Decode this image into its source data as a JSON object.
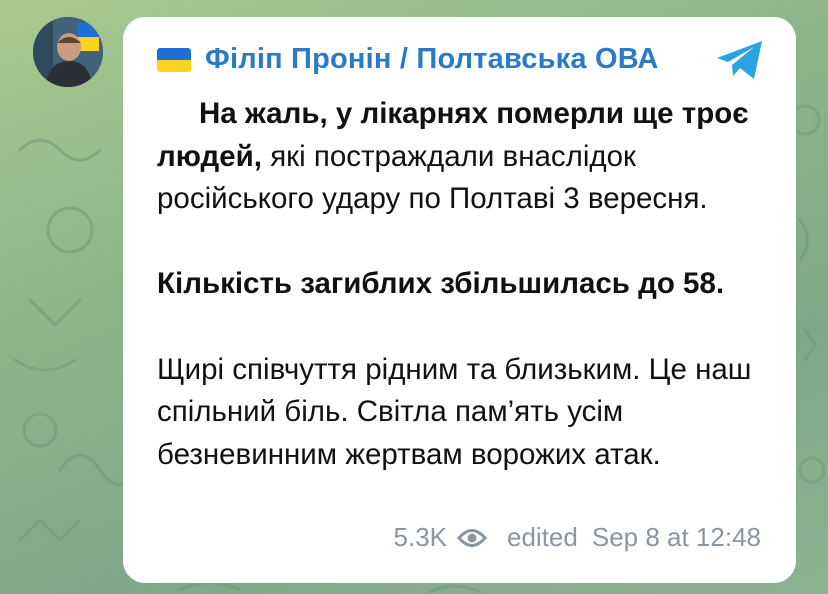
{
  "channel": {
    "name": "Філіп Пронін / Полтавська ОВА"
  },
  "message": {
    "paragraph1": {
      "bold": "На жаль, у лікарнях померли ще троє людей,",
      "normal": " які постраждали внаслідок російського удару по Полтаві 3 вересня."
    },
    "paragraph2": "Кількість загиблих збільшилась до 58.",
    "paragraph3": "Щирі співчуття рідним та близьким. Це наш спільний біль. Світла пам’ять усім безневинним жертвам ворожих атак."
  },
  "footer": {
    "views": "5.3K",
    "edited_label": "edited",
    "timestamp": "Sep 8 at 12:48"
  },
  "icons": {
    "flag": "ukraine-flag-icon",
    "telegram": "telegram-icon",
    "views": "eye-icon"
  },
  "colors": {
    "sender": "#2a7bc6",
    "telegram": "#2aa3e0",
    "flag_blue": "#1f6fd6",
    "flag_yellow": "#ffd21f",
    "meta": "#8b96a0"
  }
}
